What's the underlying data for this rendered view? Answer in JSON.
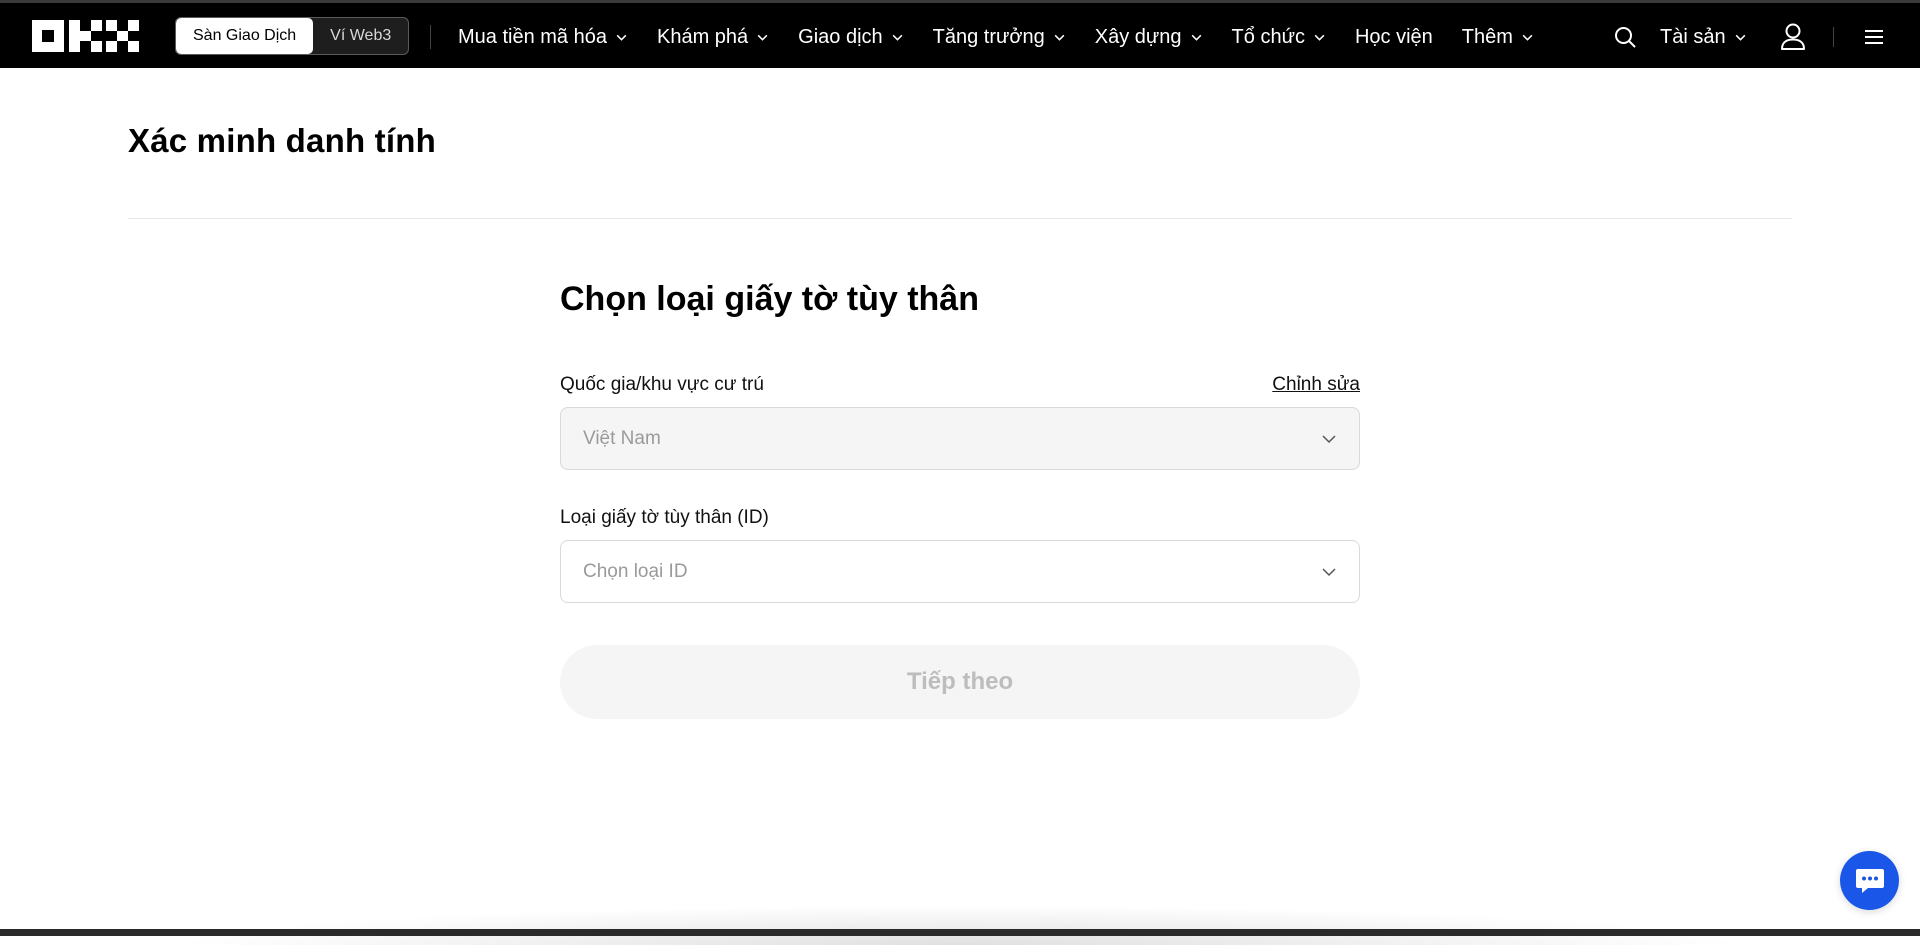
{
  "colors": {
    "topbar_bg": "#000000",
    "accent_chat": "#1a56e8",
    "disabled_button_bg": "#f5f5f5",
    "disabled_text": "#bdbdbd"
  },
  "header": {
    "logo_icon": "okx-logo-icon",
    "mode_switch": {
      "exchange_label": "Sàn Giao Dịch",
      "web3_label": "Ví Web3",
      "active": "exchange"
    },
    "nav": [
      {
        "label": "Mua tiền mã hóa",
        "has_dropdown": true
      },
      {
        "label": "Khám phá",
        "has_dropdown": true
      },
      {
        "label": "Giao dịch",
        "has_dropdown": true
      },
      {
        "label": "Tăng trưởng",
        "has_dropdown": true
      },
      {
        "label": "Xây dựng",
        "has_dropdown": true
      },
      {
        "label": "Tổ chức",
        "has_dropdown": true
      },
      {
        "label": "Học viện",
        "has_dropdown": false
      },
      {
        "label": "Thêm",
        "has_dropdown": true
      }
    ],
    "search_icon": "search-icon",
    "assets_label": "Tài sản",
    "user_icon": "user-icon",
    "menu_icon": "hamburger-menu-icon"
  },
  "page": {
    "title": "Xác minh danh tính"
  },
  "form": {
    "title": "Chọn loại giấy tờ tùy thân",
    "country": {
      "label": "Quốc gia/khu vực cư trú",
      "edit_label": "Chỉnh sửa",
      "value": "Việt Nam",
      "disabled": true
    },
    "id_type": {
      "label": "Loại giấy tờ tùy thân (ID)",
      "placeholder": "Chọn loại ID"
    },
    "next_label": "Tiếp theo",
    "next_disabled": true
  },
  "chat": {
    "icon": "chat-bubble-icon"
  }
}
